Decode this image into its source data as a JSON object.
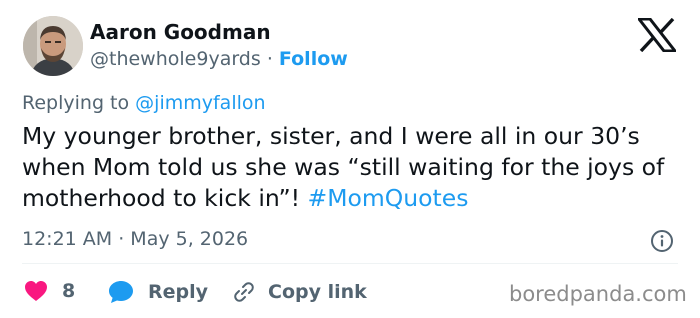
{
  "user": {
    "name": "Aaron Goodman",
    "handle": "@thewhole9yards",
    "separator": "·",
    "follow_label": "Follow"
  },
  "reply_context": {
    "prefix": "Replying to",
    "mention": "@jimmyfallon"
  },
  "tweet": {
    "text": "My younger brother, sister, and I were all in our 30’s when Mom told us she was “still waiting for the joys of motherhood to kick in”!",
    "hashtag": "#MomQuotes"
  },
  "meta": {
    "timestamp": "12:21 AM · May 5, 2026"
  },
  "actions": {
    "like_count": "8",
    "reply_label": "Reply",
    "copy_label": "Copy link"
  },
  "watermark": "boredpanda.com",
  "colors": {
    "accent": "#1d9bf0",
    "like": "#f91880",
    "text": "#0f1419",
    "secondary": "#536471"
  },
  "icons": [
    "x-logo-icon",
    "info-icon",
    "heart-icon",
    "reply-bubble-icon",
    "link-icon"
  ]
}
